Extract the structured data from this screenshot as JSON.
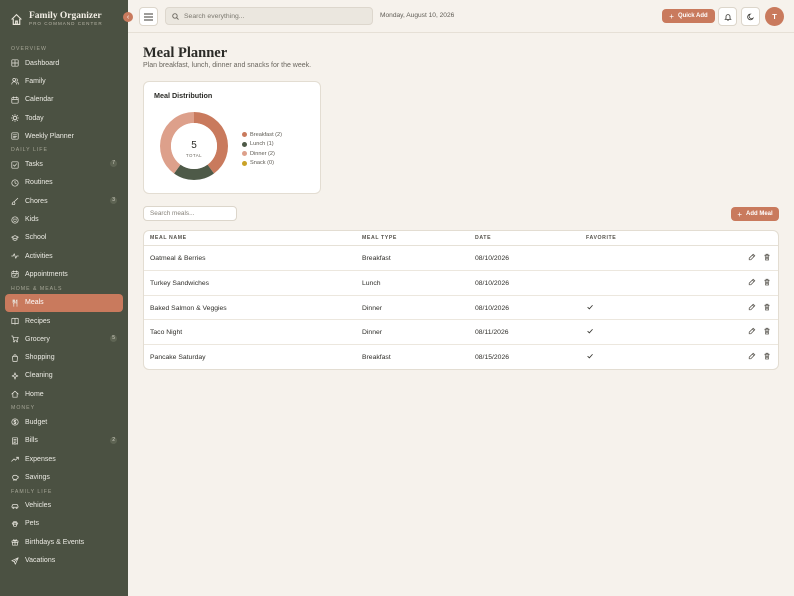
{
  "app": {
    "name": "Family Organizer",
    "tagline": "PRO COMMAND CENTER"
  },
  "sidebar": {
    "sections": [
      {
        "label": "OVERVIEW",
        "items": [
          {
            "label": "Dashboard",
            "icon": "grid-icon"
          },
          {
            "label": "Family",
            "icon": "users-icon"
          },
          {
            "label": "Calendar",
            "icon": "calendar-icon"
          },
          {
            "label": "Today",
            "icon": "sun-icon"
          },
          {
            "label": "Weekly Planner",
            "icon": "planner-icon"
          }
        ]
      },
      {
        "label": "DAILY LIFE",
        "items": [
          {
            "label": "Tasks",
            "icon": "checkbox-icon",
            "badge": "7"
          },
          {
            "label": "Routines",
            "icon": "clock-icon"
          },
          {
            "label": "Chores",
            "icon": "brush-icon",
            "badge": "3"
          },
          {
            "label": "Kids",
            "icon": "smile-icon"
          },
          {
            "label": "School",
            "icon": "graduation-icon"
          },
          {
            "label": "Activities",
            "icon": "activity-icon"
          },
          {
            "label": "Appointments",
            "icon": "calendar-check-icon"
          }
        ]
      },
      {
        "label": "HOME & MEALS",
        "items": [
          {
            "label": "Meals",
            "icon": "utensils-icon",
            "active": true
          },
          {
            "label": "Recipes",
            "icon": "book-icon"
          },
          {
            "label": "Grocery",
            "icon": "cart-icon",
            "badge": "5"
          },
          {
            "label": "Shopping",
            "icon": "bag-icon"
          },
          {
            "label": "Cleaning",
            "icon": "sparkle-icon"
          },
          {
            "label": "Home",
            "icon": "house-icon"
          }
        ]
      },
      {
        "label": "MONEY",
        "items": [
          {
            "label": "Budget",
            "icon": "dollar-icon"
          },
          {
            "label": "Bills",
            "icon": "receipt-icon",
            "badge": "2"
          },
          {
            "label": "Expenses",
            "icon": "trend-icon"
          },
          {
            "label": "Savings",
            "icon": "piggy-icon"
          }
        ]
      },
      {
        "label": "FAMILY LIFE",
        "items": [
          {
            "label": "Vehicles",
            "icon": "car-icon"
          },
          {
            "label": "Pets",
            "icon": "paw-icon"
          },
          {
            "label": "Birthdays & Events",
            "icon": "gift-icon"
          },
          {
            "label": "Vacations",
            "icon": "plane-icon"
          }
        ]
      }
    ]
  },
  "topbar": {
    "search_placeholder": "Search everything...",
    "date": "Monday, August 10, 2026",
    "quick_add_label": "Quick Add",
    "avatar_initial": "T"
  },
  "page": {
    "title": "Meal Planner",
    "subtitle": "Plan breakfast, lunch, dinner and snacks for the week."
  },
  "chart_card": {
    "title": "Meal Distribution",
    "total_value": "5",
    "total_label": "TOTAL"
  },
  "chart_data": {
    "type": "pie",
    "title": "Meal Distribution",
    "categories": [
      "Breakfast",
      "Lunch",
      "Dinner",
      "Snack"
    ],
    "values": [
      2,
      1,
      2,
      0
    ],
    "legend_labels": [
      "Breakfast (2)",
      "Lunch (1)",
      "Dinner (2)",
      "Snack (0)"
    ],
    "colors": [
      "#c97a5d",
      "#4e5a48",
      "#dda08b",
      "#c9a227"
    ],
    "center_label": "5",
    "center_sublabel": "TOTAL"
  },
  "meals": {
    "search_placeholder": "Search meals...",
    "add_label": "Add Meal",
    "columns": [
      "MEAL NAME",
      "MEAL TYPE",
      "DATE",
      "FAVORITE"
    ],
    "rows": [
      {
        "name": "Oatmeal & Berries",
        "type": "Breakfast",
        "date": "08/10/2026",
        "favorite": false
      },
      {
        "name": "Turkey Sandwiches",
        "type": "Lunch",
        "date": "08/10/2026",
        "favorite": false
      },
      {
        "name": "Baked Salmon & Veggies",
        "type": "Dinner",
        "date": "08/10/2026",
        "favorite": true
      },
      {
        "name": "Taco Night",
        "type": "Dinner",
        "date": "08/11/2026",
        "favorite": true
      },
      {
        "name": "Pancake Saturday",
        "type": "Breakfast",
        "date": "08/15/2026",
        "favorite": true
      }
    ]
  },
  "colors": {
    "sidebar_bg": "#4b5142",
    "accent": "#c97a5d",
    "page_bg": "#f6f2ec"
  }
}
